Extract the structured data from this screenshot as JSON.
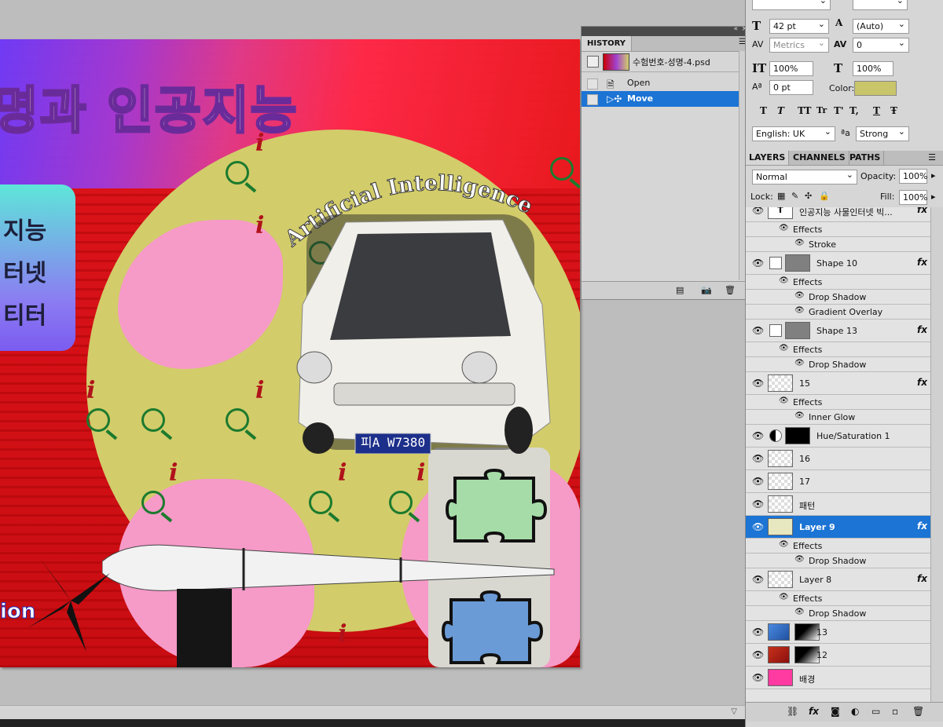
{
  "canvas": {
    "title_text": "명과 인공지능",
    "menu_lines": [
      "지능",
      "터넷",
      "티터"
    ],
    "arc_text": "Artificial Intelligence",
    "plate_text": "피A W7380",
    "bottom_text": "ion"
  },
  "history": {
    "tab_label": "HISTORY",
    "snapshot_name": "수험번호-성명-4.psd",
    "steps": [
      {
        "label": "Open",
        "selected": false
      },
      {
        "label": "Move",
        "selected": true
      }
    ]
  },
  "character": {
    "font_size": "42 pt",
    "leading": "(Auto)",
    "kerning": "Metrics",
    "tracking": "0",
    "vertical_scale": "100%",
    "horizontal_scale": "100%",
    "baseline_shift": "0 pt",
    "color_label": "Color:",
    "color_swatch": "#c9c56a",
    "style_buttons": [
      "T",
      "T",
      "TT",
      "Tr",
      "T'",
      "T,",
      "T",
      "Ŧ"
    ],
    "language": "English: UK",
    "aa_label": "ªa",
    "antialias": "Strong"
  },
  "layers_panel": {
    "tabs": [
      "LAYERS",
      "CHANNELS",
      "PATHS"
    ],
    "blend_mode": "Normal",
    "opacity_label": "Opacity:",
    "opacity": "100%",
    "lock_label": "Lock:",
    "fill_label": "Fill:",
    "fill": "100%",
    "rows": [
      {
        "kind": "layer",
        "name": "인공지능 사물인터넷 빅...",
        "thumb": "T",
        "fx": true
      },
      {
        "kind": "effects",
        "name": "Effects"
      },
      {
        "kind": "effect",
        "name": "Stroke"
      },
      {
        "kind": "layer",
        "name": "Shape 10",
        "fx": true
      },
      {
        "kind": "effects",
        "name": "Effects"
      },
      {
        "kind": "effect",
        "name": "Drop Shadow"
      },
      {
        "kind": "effect",
        "name": "Gradient Overlay"
      },
      {
        "kind": "layer",
        "name": "Shape 13",
        "fx": true
      },
      {
        "kind": "effects",
        "name": "Effects"
      },
      {
        "kind": "effect",
        "name": "Drop Shadow"
      },
      {
        "kind": "layer",
        "name": "15",
        "fx": true
      },
      {
        "kind": "effects",
        "name": "Effects"
      },
      {
        "kind": "effect",
        "name": "Inner Glow"
      },
      {
        "kind": "layer",
        "name": "Hue/Saturation 1",
        "fx": false
      },
      {
        "kind": "layer",
        "name": "16",
        "fx": false
      },
      {
        "kind": "layer",
        "name": "17",
        "fx": false
      },
      {
        "kind": "layer",
        "name": "패턴",
        "fx": false
      },
      {
        "kind": "layer",
        "name": "Layer 9",
        "fx": true,
        "selected": true
      },
      {
        "kind": "effects",
        "name": "Effects"
      },
      {
        "kind": "effect",
        "name": "Drop Shadow"
      },
      {
        "kind": "layer",
        "name": "Layer 8",
        "fx": true
      },
      {
        "kind": "effects",
        "name": "Effects"
      },
      {
        "kind": "effect",
        "name": "Drop Shadow"
      },
      {
        "kind": "layer",
        "name": "13",
        "fx": false
      },
      {
        "kind": "layer",
        "name": "12",
        "fx": false
      },
      {
        "kind": "layer",
        "name": "배경",
        "fx": false
      }
    ]
  }
}
